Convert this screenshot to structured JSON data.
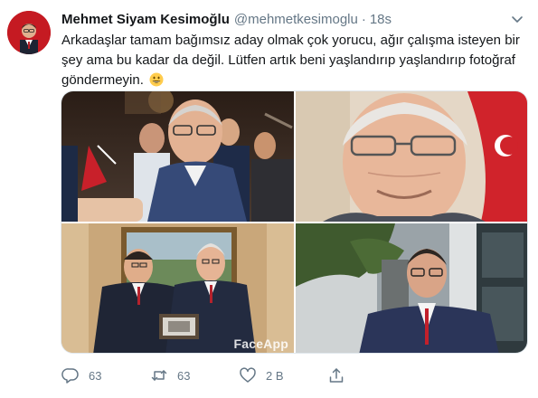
{
  "author": {
    "name": "Mehmet Siyam Kesimoğlu",
    "handle": "@mehmetkesimoglu",
    "separator": "·",
    "timestamp": "18s"
  },
  "tweet": {
    "text": "Arkadaşlar tamam bağımsız aday olmak çok yorucu, ağır çalışma isteyen bir şey ama bu kadar da değil. Lütfen artık beni yaşlandırıp yaşlandırıp fotoğraf göndermeyin."
  },
  "media": {
    "watermark": "FaceApp"
  },
  "actions": {
    "reply_count": "63",
    "retweet_count": "63",
    "like_count": "2 B"
  },
  "colors": {
    "text_primary": "#14171a",
    "text_secondary": "#657786",
    "border": "#e1e8ed"
  }
}
